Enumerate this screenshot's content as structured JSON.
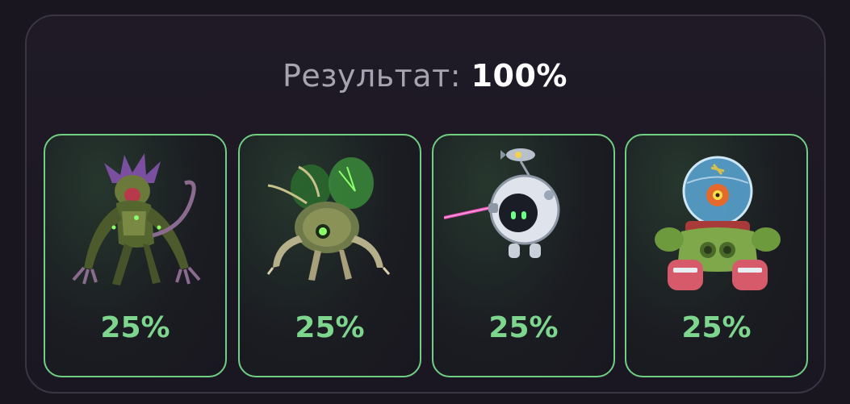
{
  "result": {
    "label": "Результат:",
    "value": "100%"
  },
  "cards": [
    {
      "name": "monster-1",
      "percent": "25%",
      "icon": "mutant-creature-icon"
    },
    {
      "name": "monster-2",
      "percent": "25%",
      "icon": "bug-robot-icon"
    },
    {
      "name": "monster-3",
      "percent": "25%",
      "icon": "orb-robot-icon"
    },
    {
      "name": "monster-4",
      "percent": "25%",
      "icon": "fishbowl-mech-icon"
    }
  ],
  "colors": {
    "accent_green": "#7ed68e",
    "card_border": "#6fcf82",
    "background": "#1a1620"
  }
}
